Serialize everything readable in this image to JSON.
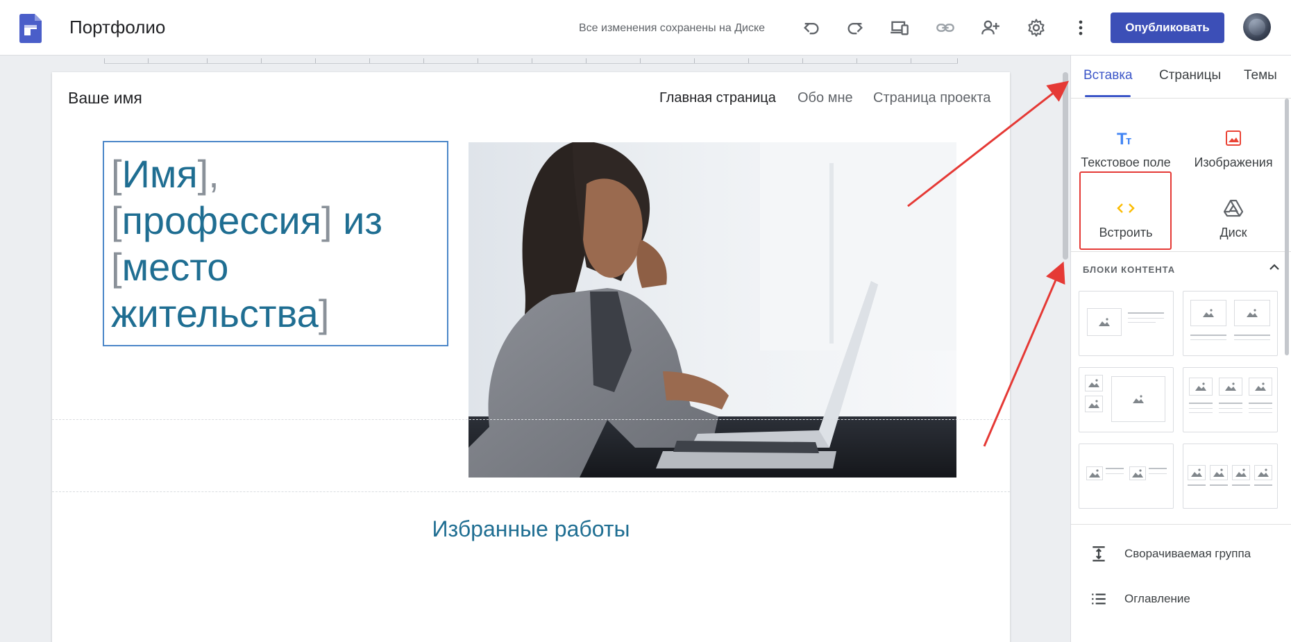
{
  "app": {
    "doc_title": "Портфолио",
    "save_status": "Все изменения сохранены на Диске",
    "publish_label": "Опубликовать",
    "logo_icon": "google-sites-logo-icon",
    "brand_color": "#3c4fb7"
  },
  "toolbar": {
    "icons": [
      "undo-icon",
      "redo-icon",
      "preview-devices-icon",
      "link-icon",
      "share-icon",
      "settings-icon",
      "more-vert-icon"
    ]
  },
  "site": {
    "name": "Ваше имя",
    "nav": [
      "Главная страница",
      "Обо мне",
      "Страница проекта"
    ],
    "hero": {
      "l1a": "[",
      "l1b": "Имя",
      "l1c": "],",
      "l2a": "[",
      "l2b": "профессия",
      "l2c": "]",
      "l2d": " из",
      "l3a": "[",
      "l3b": "место",
      "l4a": "жительства",
      "l4b": "]"
    },
    "section_title": "Избранные работы",
    "text_color": "#1f6e92"
  },
  "panel": {
    "tabs": [
      "Вставка",
      "Страницы",
      "Темы"
    ],
    "active_tab": "Вставка",
    "insert_items": [
      {
        "label": "Текстовое поле",
        "icon": "text-box-icon"
      },
      {
        "label": "Изображения",
        "icon": "image-icon"
      },
      {
        "label": "Встроить",
        "icon": "embed-code-icon"
      },
      {
        "label": "Диск",
        "icon": "drive-icon"
      }
    ],
    "blocks_heading": "БЛОКИ КОНТЕНТА",
    "list_items": [
      {
        "label": "Сворачиваемая группа",
        "icon": "collapsible-group-icon"
      },
      {
        "label": "Оглавление",
        "icon": "table-of-contents-icon"
      }
    ],
    "accent_color": "#3c56c8",
    "highlight_color": "#e53935"
  }
}
